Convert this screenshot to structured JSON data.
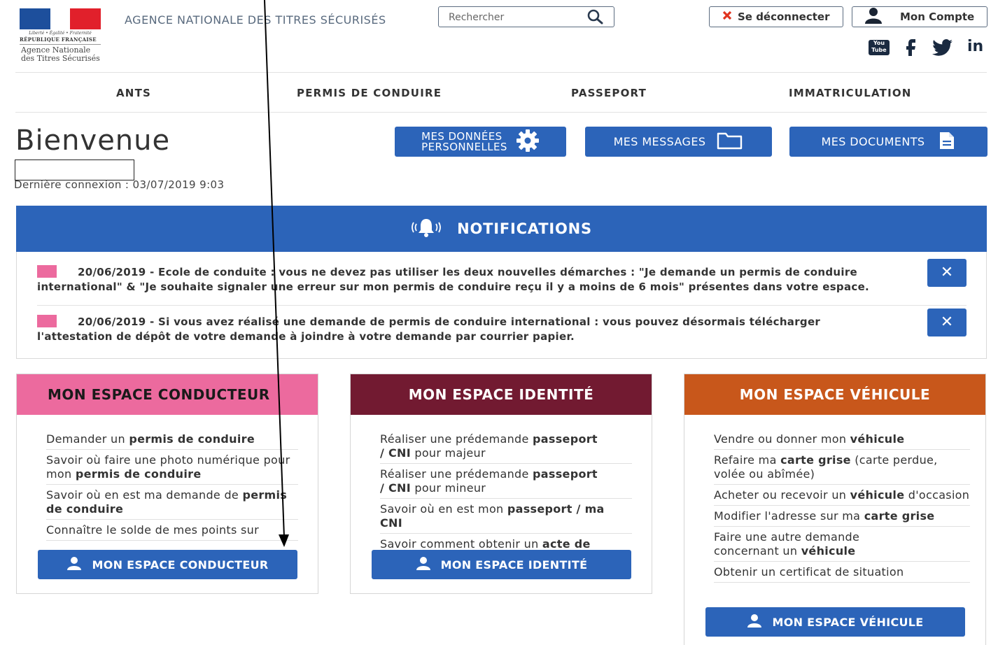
{
  "header": {
    "logo_motto": "Liberté • Égalité • Fraternité",
    "logo_republic": "RÉPUBLIQUE FRANÇAISE",
    "logo_agency_line1": "Agence Nationale",
    "logo_agency_line2": "des Titres Sécurisés",
    "agency_title": "AGENCE NATIONALE DES TITRES SÉCURISÉS",
    "search_placeholder": "Rechercher",
    "logout_label": "Se déconnecter",
    "account_label": "Mon Compte",
    "youtube_label_top": "You",
    "youtube_label_bottom": "Tube",
    "linkedin_label": "in"
  },
  "nav": {
    "items": [
      "ANTS",
      "PERMIS DE CONDUIRE",
      "PASSEPORT",
      "IMMATRICULATION"
    ]
  },
  "welcome": {
    "title": "Bienvenue",
    "last_connection": "Dernière connexion : 03/07/2019 9:03"
  },
  "top_buttons": {
    "personal_data_line1": "MES DONNÉES",
    "personal_data_line2": "PERSONNELLES",
    "messages": "MES MESSAGES",
    "documents": "MES DOCUMENTS"
  },
  "notifications": {
    "title": "NOTIFICATIONS",
    "items": [
      {
        "line1": "20/06/2019 - Ecole de conduite : vous ne devez pas utiliser les deux nouvelles démarches : \"Je demande un permis de conduire",
        "line2": "international\" & \"Je souhaite signaler une erreur sur mon permis de conduire reçu il y a moins de 6 mois\" présentes dans votre espace.",
        "close": "✕"
      },
      {
        "line1": "20/06/2019 - Si vous avez réalisé une demande de permis de conduire international : vous pouvez désormais télécharger",
        "line2": "l'attestation de dépôt de votre demande à joindre à votre demande par courrier papier.",
        "close": "✕"
      }
    ]
  },
  "cards": {
    "conducteur": {
      "title": "MON ESPACE CONDUCTEUR",
      "color": "#ec6a9e",
      "button": "MON ESPACE CONDUCTEUR",
      "links": [
        {
          "pre": "Demander un ",
          "bold": "permis de conduire",
          "post": ""
        },
        {
          "pre": "Savoir où faire une photo numérique pour mon ",
          "bold": "permis de conduire",
          "post": ""
        },
        {
          "pre": "Savoir où en est ma demande de ",
          "bold": "permis de conduire",
          "post": ""
        },
        {
          "pre": "Connaître le solde de mes points sur",
          "bold": "",
          "post": ""
        }
      ]
    },
    "identite": {
      "title": "MON ESPACE IDENTITÉ",
      "color": "#721a31",
      "button": "MON ESPACE IDENTITÉ",
      "links": [
        {
          "pre": "Réaliser une prédemande ",
          "bold": "passeport / CNI",
          "post": " pour majeur"
        },
        {
          "pre": "Réaliser une prédemande ",
          "bold": "passeport / CNI",
          "post": " pour mineur"
        },
        {
          "pre": "Savoir où en est mon ",
          "bold": "passeport / ma CNI",
          "post": ""
        },
        {
          "pre": "Savoir comment obtenir un ",
          "bold": "acte de",
          "post": ""
        }
      ]
    },
    "vehicule": {
      "title": "MON ESPACE VÉHICULE",
      "color": "#c8571b",
      "button": "MON ESPACE VÉHICULE",
      "links": [
        {
          "pre": "Vendre ou donner mon ",
          "bold": "véhicule",
          "post": ""
        },
        {
          "pre": "Refaire ma ",
          "bold": "carte grise",
          "post": " (carte perdue, volée ou abîmée)"
        },
        {
          "pre": "Acheter ou recevoir un ",
          "bold": "véhicule",
          "post": " d'occasion"
        },
        {
          "pre": "Modifier l'adresse sur ma ",
          "bold": "carte grise",
          "post": ""
        },
        {
          "pre": "Faire une autre demande concernant un ",
          "bold": "véhicule",
          "post": ""
        },
        {
          "pre": "Obtenir un certificat de situation",
          "bold": "",
          "post": ""
        }
      ]
    }
  },
  "colors": {
    "primary_blue": "#2c64b9",
    "notification_marker": "#ec6a9e",
    "annotation_arrow": "#000000"
  }
}
